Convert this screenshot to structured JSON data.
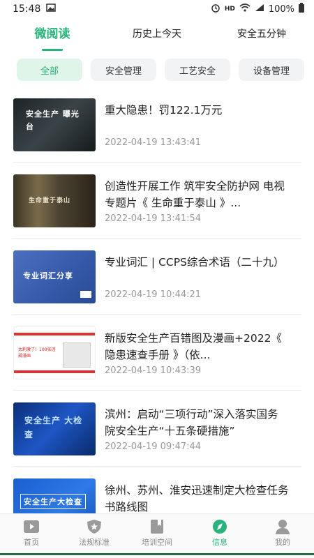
{
  "status": {
    "time": "15:48",
    "network": "HD",
    "battery": "100%"
  },
  "top_tabs": [
    {
      "label": "微阅读",
      "active": true
    },
    {
      "label": "历史上今天",
      "active": false
    },
    {
      "label": "安全五分钟",
      "active": false
    }
  ],
  "chips": [
    {
      "label": "全部",
      "active": true
    },
    {
      "label": "安全管理",
      "active": false
    },
    {
      "label": "工艺安全",
      "active": false
    },
    {
      "label": "设备管理",
      "active": false
    }
  ],
  "articles": [
    {
      "title": "重大隐患！罚122.1万元",
      "date": "2022-04-19 13:43:41",
      "thumb_text": "安全生产 曝光台"
    },
    {
      "title": "创造性开展工作 筑牢安全防护网 电视专题片《 生命重于泰山 》...",
      "date": "2022-04-19 13:41:54",
      "thumb_text": "生命重于泰山"
    },
    {
      "title": "专业词汇 | CCPS综合术语（二十九）",
      "date": "2022-04-19 10:44:21",
      "thumb_text": "专业词汇分享"
    },
    {
      "title": "新版安全生产百错图及漫画+2022《 隐患速查手册 》（依...",
      "date": "2022-04-19 10:43:39",
      "thumb_text": "太刺激了！100张违规漫画"
    },
    {
      "title": "滨州：启动“三项行动”深入落实国务院安全生产“十五条硬措施”",
      "date": "2022-04-19 09:47:44",
      "thumb_text": "安全生产 大检查"
    },
    {
      "title": "徐州、苏州、淮安迅速制定大检查任务书路线图",
      "date": "",
      "thumb_text": "安全生产大检查"
    }
  ],
  "bottom_nav": [
    {
      "label": "首页",
      "icon": "home-icon",
      "active": false
    },
    {
      "label": "法规标准",
      "icon": "shield-star-icon",
      "active": false
    },
    {
      "label": "培训空间",
      "icon": "bookmark-book-icon",
      "active": false
    },
    {
      "label": "信息",
      "icon": "compass-icon",
      "active": true
    },
    {
      "label": "我的",
      "icon": "person-icon",
      "active": false
    }
  ],
  "colors": {
    "accent": "#27b37a",
    "chip_bg": "#f2f3f5",
    "chip_active_bg": "#dff5ea",
    "text_secondary": "#999999"
  }
}
